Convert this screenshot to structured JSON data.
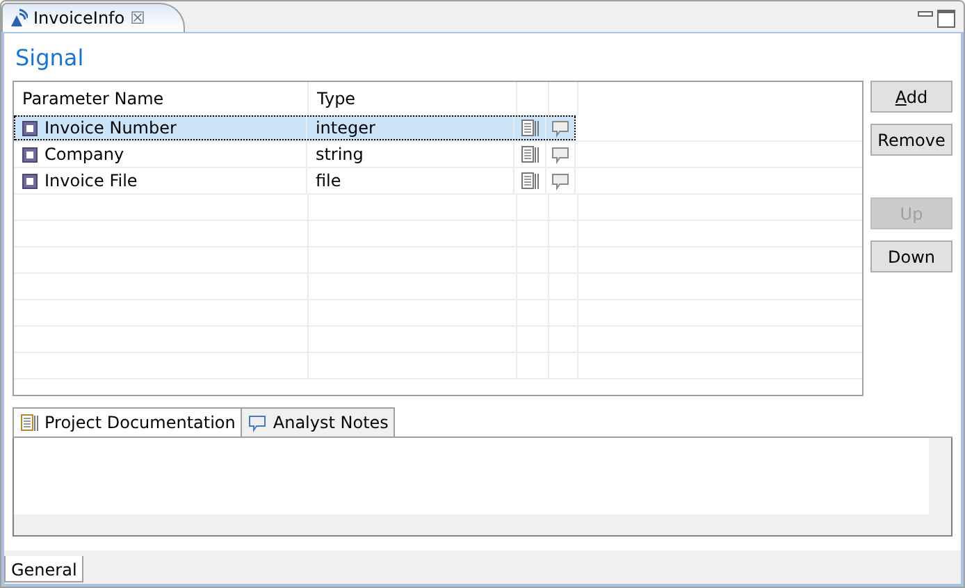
{
  "editor_tab": {
    "title": "InvoiceInfo",
    "close": "☒"
  },
  "heading": "Signal",
  "table": {
    "columns": [
      "Parameter Name",
      "Type"
    ],
    "rows": [
      {
        "name": "Invoice Number",
        "type": "integer",
        "selected": true
      },
      {
        "name": "Company",
        "type": "string",
        "selected": false
      },
      {
        "name": "Invoice File",
        "type": "file",
        "selected": false
      }
    ]
  },
  "buttons": [
    {
      "label": "Add",
      "disabled": false,
      "kind": "button"
    },
    {
      "label": "Remove",
      "disabled": false,
      "kind": "button"
    },
    {
      "kind": "gap"
    },
    {
      "label": "Up",
      "disabled": true,
      "kind": "button"
    },
    {
      "label": "Down",
      "disabled": false,
      "kind": "button"
    }
  ],
  "doc_tabs": [
    {
      "label": "Project Documentation",
      "kind": "doc",
      "selected": true
    },
    {
      "label": "Analyst Notes",
      "kind": "note",
      "selected": false
    }
  ],
  "bottom_tabs": [
    {
      "label": "General",
      "selected": true
    }
  ]
}
